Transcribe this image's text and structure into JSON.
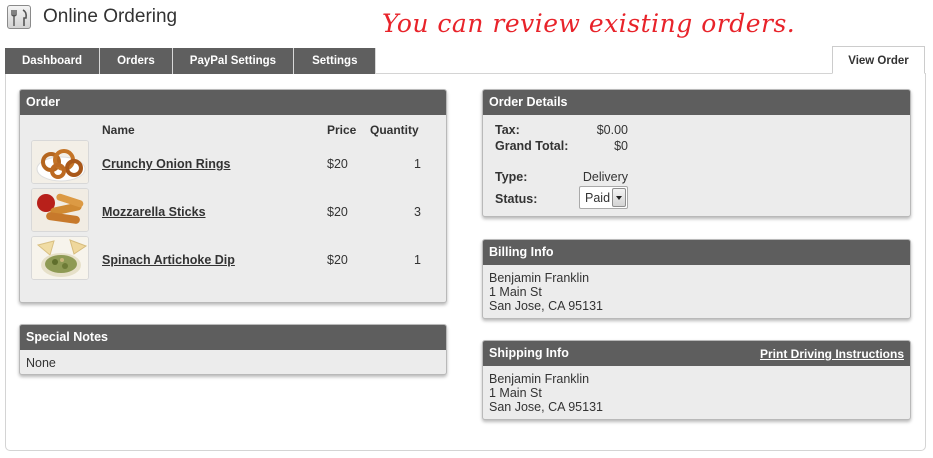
{
  "app": {
    "title": "Online Ordering",
    "annotation": "You can review existing orders."
  },
  "tabs": [
    {
      "label": "Dashboard"
    },
    {
      "label": "Orders"
    },
    {
      "label": "PayPal Settings"
    },
    {
      "label": "Settings"
    }
  ],
  "active_tab": {
    "label": "View Order"
  },
  "order": {
    "title": "Order",
    "columns": {
      "name": "Name",
      "price": "Price",
      "quantity": "Quantity"
    },
    "items": [
      {
        "name": "Crunchy Onion Rings",
        "price": "$20",
        "quantity": "1",
        "image": "onion-rings-photo"
      },
      {
        "name": "Mozzarella Sticks",
        "price": "$20",
        "quantity": "3",
        "image": "mozzarella-sticks-photo"
      },
      {
        "name": "Spinach Artichoke Dip",
        "price": "$20",
        "quantity": "1",
        "image": "spinach-dip-photo"
      }
    ]
  },
  "notes": {
    "title": "Special Notes",
    "text": "None"
  },
  "details": {
    "title": "Order Details",
    "tax_label": "Tax:",
    "tax_value": "$0.00",
    "total_label": "Grand Total:",
    "total_value": "$0",
    "type_label": "Type:",
    "type_value": "Delivery",
    "status_label": "Status:",
    "status_value": "Paid"
  },
  "billing": {
    "title": "Billing Info",
    "name": "Benjamin Franklin",
    "street": "1 Main St",
    "city": "San Jose, CA 95131"
  },
  "shipping": {
    "title": "Shipping Info",
    "link": "Print Driving Instructions",
    "name": "Benjamin Franklin",
    "street": "1 Main St",
    "city": "San Jose, CA 95131"
  },
  "colors": {
    "header_bg": "#5e5e5e",
    "panel_bg": "#ececec",
    "annotation": "#e8232a"
  }
}
